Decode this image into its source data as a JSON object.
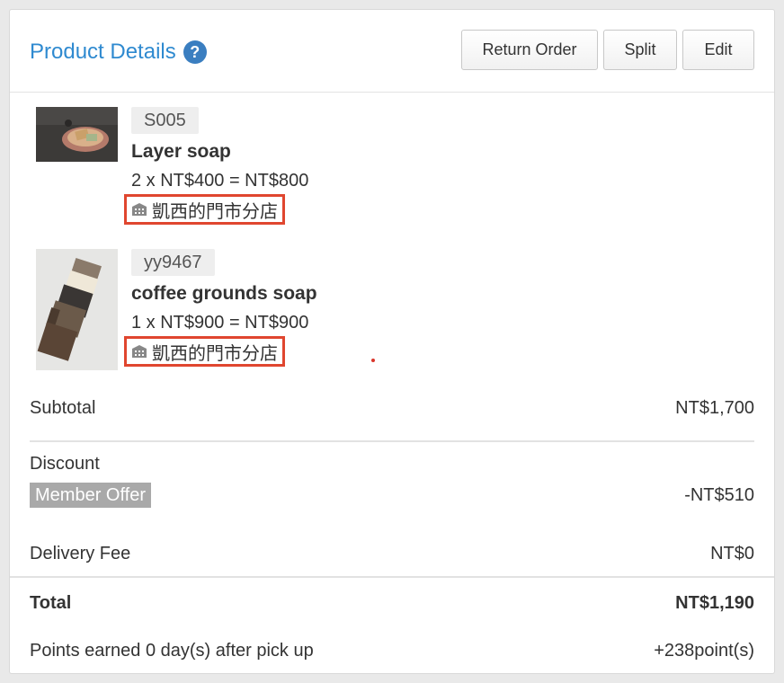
{
  "header": {
    "title": "Product Details",
    "help_icon": "?",
    "buttons": {
      "return_order": "Return Order",
      "split": "Split",
      "edit": "Edit"
    }
  },
  "products": [
    {
      "sku": "S005",
      "name": "Layer soap",
      "price_line": "2 x NT$400 = NT$800",
      "store": "凱西的門市分店",
      "thumb_icon": "soap-dish-photo"
    },
    {
      "sku": "yy9467",
      "name": "coffee grounds soap",
      "price_line": "1 x NT$900 = NT$900",
      "store": "凱西的門市分店",
      "thumb_icon": "soap-bars-photo"
    }
  ],
  "summary": {
    "subtotal_label": "Subtotal",
    "subtotal_value": "NT$1,700",
    "discount_label": "Discount",
    "member_offer_label": "Member Offer",
    "member_offer_value": "-NT$510",
    "delivery_label": "Delivery Fee",
    "delivery_value": "NT$0",
    "total_label": "Total",
    "total_value": "NT$1,190",
    "points_label": "Points earned 0 day(s) after pick up",
    "points_value": "+238point(s)"
  },
  "colors": {
    "title": "#2f8ad0",
    "help_icon": "#3a7ec0",
    "highlight_border": "#e0462f",
    "member_offer_bg": "#a9a9a9"
  }
}
